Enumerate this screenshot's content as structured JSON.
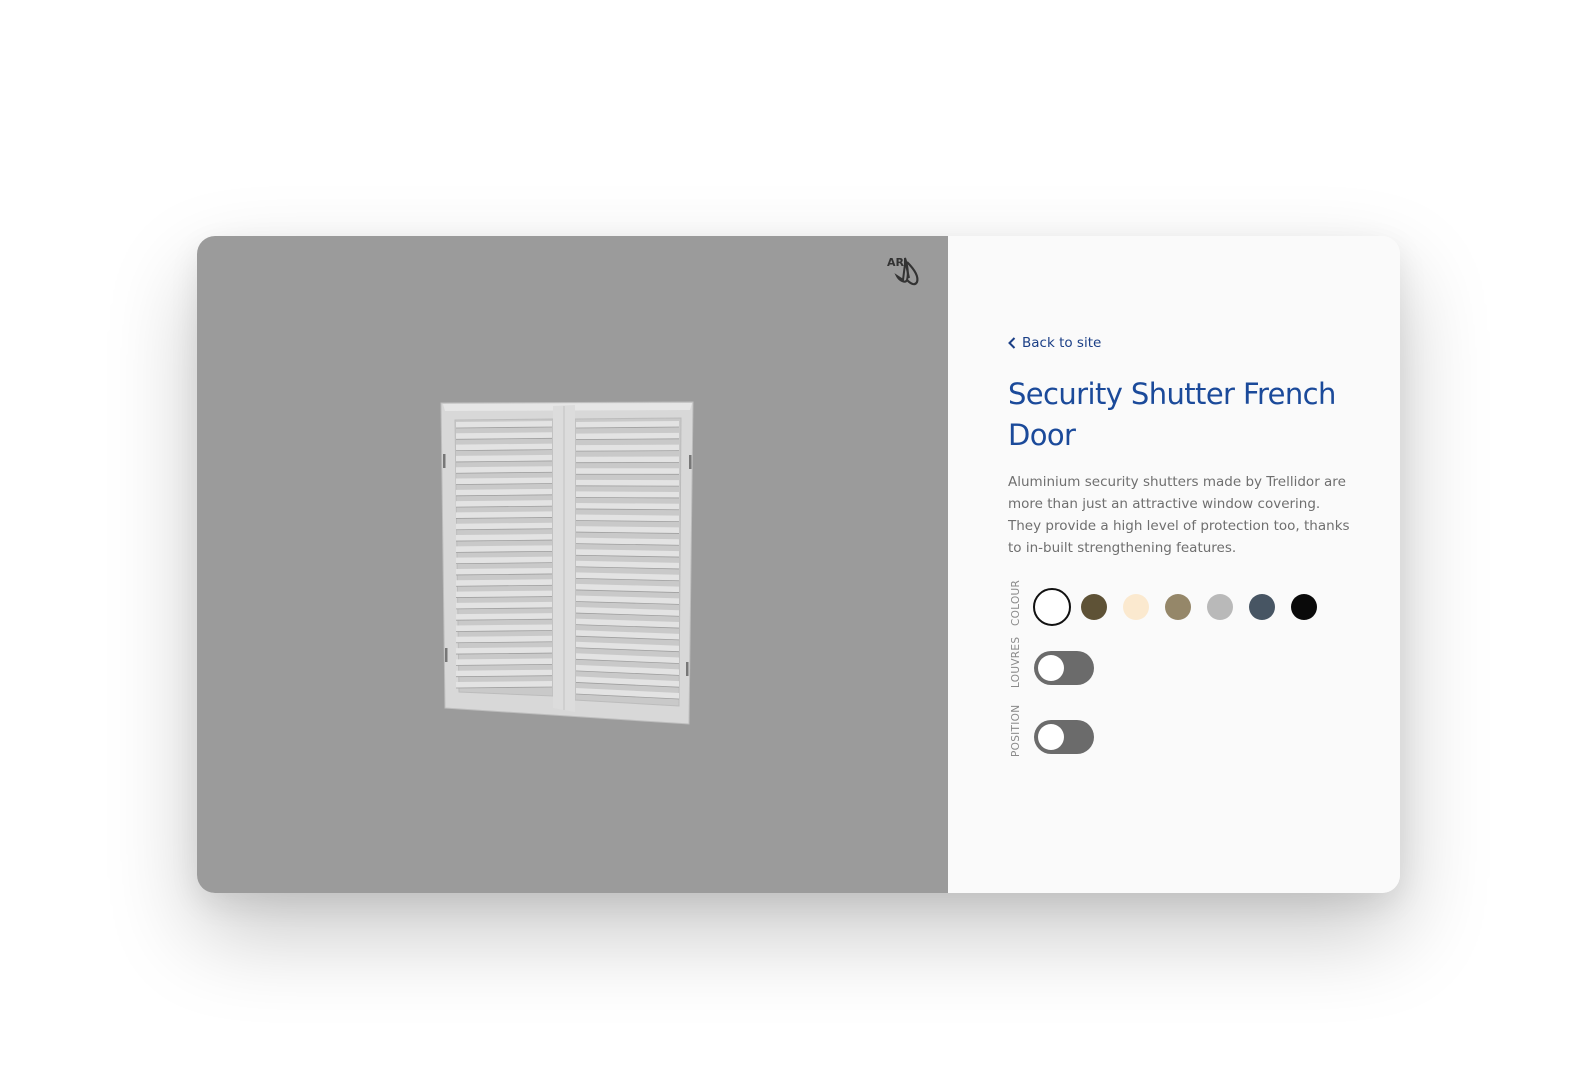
{
  "viewer": {
    "background": "#9b9b9b",
    "ar_label": "AR",
    "ar_icon": "ar-hand-icon",
    "model_name": "security-shutter-french-door-model"
  },
  "panel": {
    "back_link": "Back to site",
    "back_icon": "chevron-left-icon",
    "title": "Security Shutter French Door",
    "description": "Aluminium security shutters made by Trellidor are more than just an attractive window covering. They provide a high level of protection too, thanks to in-built strengthening features.",
    "options": {
      "colour": {
        "label": "COLOUR",
        "swatches": [
          {
            "name": "white",
            "color": "#ffffff",
            "selected": true
          },
          {
            "name": "bronze",
            "color": "#5e5236",
            "selected": false
          },
          {
            "name": "ivory",
            "color": "#fbe9cf",
            "selected": false
          },
          {
            "name": "sand",
            "color": "#958769",
            "selected": false
          },
          {
            "name": "silver",
            "color": "#b9b9b9",
            "selected": false
          },
          {
            "name": "charcoal",
            "color": "#475563",
            "selected": false
          },
          {
            "name": "black",
            "color": "#0a0a0a",
            "selected": false
          }
        ]
      },
      "louvres": {
        "label": "LOUVRES",
        "on": false
      },
      "position": {
        "label": "POSITION",
        "on": false
      }
    }
  },
  "colors": {
    "accent": "#1b4a9a",
    "link": "#1b3f86",
    "toggle_off": "#6b6b6b"
  }
}
